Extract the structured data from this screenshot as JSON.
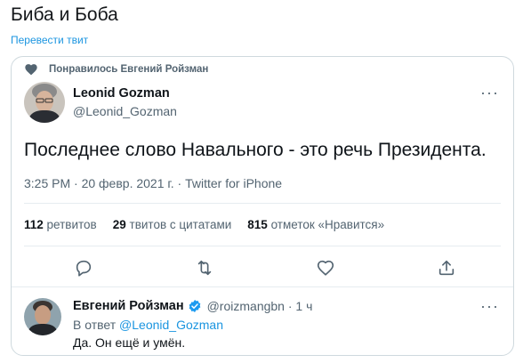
{
  "page": {
    "title": "Биба и Боба",
    "translate_link": "Перевести твит"
  },
  "tweet": {
    "liked_by": "Понравилось Евгений Ройзман",
    "author_name": "Leonid Gozman",
    "author_handle": "@Leonid_Gozman",
    "text": "Последнее слово Навального - это речь Президента.",
    "timestamp": "3:25 PM · 20 февр. 2021 г. · Twitter for iPhone",
    "stats": {
      "retweets_count": "112",
      "retweets_label": "ретвитов",
      "quotes_count": "29",
      "quotes_label": "твитов с цитатами",
      "likes_count": "815",
      "likes_label": "отметок «Нравится»"
    },
    "more_icon": "···"
  },
  "reply": {
    "author_name": "Евгений Ройзман",
    "handle_time": "@roizmangbn · 1 ч",
    "reply_to_prefix": "В ответ",
    "reply_to_mention": "@Leonid_Gozman",
    "text": "Да. Он ещё и умён.",
    "more_icon": "···"
  },
  "colors": {
    "link": "#1b95e0",
    "secondary_text": "#536471",
    "verified": "#1d9bf0",
    "border": "#cfd9de"
  },
  "icons": [
    "heart-icon",
    "reply-icon",
    "retweet-icon",
    "like-icon",
    "share-icon",
    "verified-icon",
    "more-icon"
  ]
}
